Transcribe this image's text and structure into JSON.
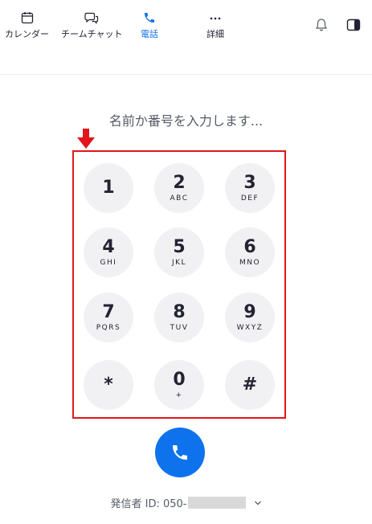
{
  "nav": {
    "tabs": [
      {
        "label": "カレンダー",
        "icon": "calendar-icon"
      },
      {
        "label": "チームチャット",
        "icon": "chat-icon"
      },
      {
        "label": "電話",
        "icon": "phone-icon",
        "active": true
      },
      {
        "label": "詳細",
        "icon": "more-icon"
      }
    ],
    "right_icons": [
      "bell-icon",
      "panel-toggle-icon"
    ]
  },
  "search": {
    "placeholder": "名前か番号を入力します..."
  },
  "keypad": {
    "keys": [
      {
        "digit": "1",
        "letters": ""
      },
      {
        "digit": "2",
        "letters": "ABC"
      },
      {
        "digit": "3",
        "letters": "DEF"
      },
      {
        "digit": "4",
        "letters": "GHI"
      },
      {
        "digit": "5",
        "letters": "JKL"
      },
      {
        "digit": "6",
        "letters": "MNO"
      },
      {
        "digit": "7",
        "letters": "PQRS"
      },
      {
        "digit": "8",
        "letters": "TUV"
      },
      {
        "digit": "9",
        "letters": "WXYZ"
      },
      {
        "digit": "*",
        "letters": ""
      },
      {
        "digit": "0",
        "letters": "+"
      },
      {
        "digit": "#",
        "letters": ""
      }
    ]
  },
  "caller_id": {
    "label": "発信者 ID: 050-"
  },
  "colors": {
    "accent": "#0e72ed",
    "highlight_border": "#e0161c",
    "key_bg": "#f1f1f4"
  }
}
